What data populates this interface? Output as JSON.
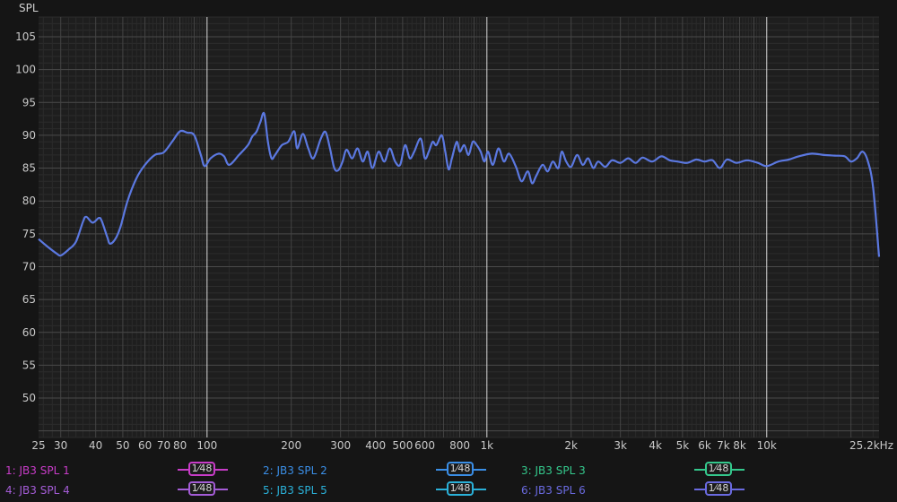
{
  "chart_data": {
    "type": "line",
    "ylabel": "SPL",
    "ylim": [
      44,
      108
    ],
    "xlim": [
      25,
      25200
    ],
    "xscale": "log",
    "grid": true,
    "y_ticks": [
      50,
      55,
      60,
      65,
      70,
      75,
      80,
      85,
      90,
      95,
      100,
      105
    ],
    "x_ticks": [
      {
        "v": 25,
        "label": "25"
      },
      {
        "v": 30,
        "label": "30"
      },
      {
        "v": 40,
        "label": "40"
      },
      {
        "v": 50,
        "label": "50"
      },
      {
        "v": 60,
        "label": "60"
      },
      {
        "v": 70,
        "label": "70"
      },
      {
        "v": 80,
        "label": "80"
      },
      {
        "v": 100,
        "label": "100"
      },
      {
        "v": 200,
        "label": "200"
      },
      {
        "v": 300,
        "label": "300"
      },
      {
        "v": 400,
        "label": "400"
      },
      {
        "v": 500,
        "label": "500"
      },
      {
        "v": 600,
        "label": "600"
      },
      {
        "v": 800,
        "label": "800"
      },
      {
        "v": 1000,
        "label": "1k"
      },
      {
        "v": 2000,
        "label": "2k"
      },
      {
        "v": 3000,
        "label": "3k"
      },
      {
        "v": 4000,
        "label": "4k"
      },
      {
        "v": 5000,
        "label": "5k"
      },
      {
        "v": 6000,
        "label": "6k"
      },
      {
        "v": 7000,
        "label": "7k"
      },
      {
        "v": 8000,
        "label": "8k"
      },
      {
        "v": 10000,
        "label": "10k"
      },
      {
        "v": 25200,
        "label": "25.2kHz"
      }
    ],
    "series": [
      {
        "name": "6: JB3 SPL 6",
        "color": "#5b78e0",
        "points": [
          [
            25,
            74.2
          ],
          [
            27,
            73.0
          ],
          [
            29,
            72.0
          ],
          [
            30,
            71.7
          ],
          [
            32,
            72.6
          ],
          [
            34,
            73.8
          ],
          [
            36,
            76.8
          ],
          [
            37,
            77.6
          ],
          [
            39,
            76.7
          ],
          [
            41,
            77.4
          ],
          [
            42,
            77.0
          ],
          [
            44,
            74.5
          ],
          [
            45,
            73.5
          ],
          [
            47,
            74.2
          ],
          [
            49,
            76.0
          ],
          [
            52,
            80.0
          ],
          [
            56,
            83.5
          ],
          [
            60,
            85.5
          ],
          [
            65,
            87.0
          ],
          [
            70,
            87.4
          ],
          [
            75,
            89.0
          ],
          [
            80,
            90.6
          ],
          [
            85,
            90.4
          ],
          [
            90,
            90.0
          ],
          [
            95,
            87.0
          ],
          [
            98,
            85.3
          ],
          [
            103,
            86.5
          ],
          [
            110,
            87.2
          ],
          [
            115,
            86.8
          ],
          [
            120,
            85.5
          ],
          [
            130,
            87.0
          ],
          [
            140,
            88.5
          ],
          [
            145,
            89.8
          ],
          [
            150,
            90.5
          ],
          [
            155,
            92.0
          ],
          [
            160,
            93.3
          ],
          [
            165,
            89.0
          ],
          [
            170,
            86.5
          ],
          [
            175,
            87.0
          ],
          [
            185,
            88.5
          ],
          [
            195,
            89.0
          ],
          [
            205,
            90.6
          ],
          [
            210,
            88.0
          ],
          [
            220,
            90.2
          ],
          [
            230,
            88.0
          ],
          [
            240,
            86.5
          ],
          [
            255,
            89.5
          ],
          [
            265,
            90.5
          ],
          [
            275,
            88.0
          ],
          [
            285,
            85.0
          ],
          [
            295,
            84.7
          ],
          [
            305,
            86.0
          ],
          [
            315,
            87.8
          ],
          [
            330,
            86.5
          ],
          [
            345,
            88.0
          ],
          [
            360,
            86.0
          ],
          [
            375,
            87.5
          ],
          [
            390,
            85.0
          ],
          [
            410,
            87.5
          ],
          [
            430,
            86.0
          ],
          [
            450,
            88.0
          ],
          [
            470,
            86.0
          ],
          [
            490,
            85.5
          ],
          [
            510,
            88.5
          ],
          [
            530,
            86.5
          ],
          [
            550,
            87.5
          ],
          [
            580,
            89.5
          ],
          [
            600,
            86.5
          ],
          [
            620,
            87.5
          ],
          [
            640,
            89.0
          ],
          [
            660,
            88.5
          ],
          [
            690,
            90.0
          ],
          [
            710,
            87.5
          ],
          [
            730,
            84.8
          ],
          [
            750,
            86.5
          ],
          [
            780,
            89.0
          ],
          [
            800,
            87.5
          ],
          [
            830,
            88.5
          ],
          [
            860,
            87.0
          ],
          [
            890,
            89.0
          ],
          [
            920,
            88.5
          ],
          [
            950,
            87.5
          ],
          [
            980,
            86.0
          ],
          [
            1010,
            87.5
          ],
          [
            1050,
            85.5
          ],
          [
            1100,
            88.0
          ],
          [
            1150,
            86.0
          ],
          [
            1200,
            87.2
          ],
          [
            1270,
            85.2
          ],
          [
            1330,
            83.0
          ],
          [
            1400,
            84.5
          ],
          [
            1450,
            82.7
          ],
          [
            1500,
            83.8
          ],
          [
            1580,
            85.5
          ],
          [
            1650,
            84.5
          ],
          [
            1720,
            86.0
          ],
          [
            1800,
            85.0
          ],
          [
            1850,
            87.5
          ],
          [
            1920,
            86.0
          ],
          [
            2000,
            85.2
          ],
          [
            2100,
            87.0
          ],
          [
            2200,
            85.5
          ],
          [
            2300,
            86.5
          ],
          [
            2400,
            85.0
          ],
          [
            2500,
            86.0
          ],
          [
            2650,
            85.2
          ],
          [
            2800,
            86.2
          ],
          [
            3000,
            85.8
          ],
          [
            3200,
            86.5
          ],
          [
            3400,
            85.8
          ],
          [
            3600,
            86.6
          ],
          [
            3900,
            86.0
          ],
          [
            4200,
            86.8
          ],
          [
            4500,
            86.2
          ],
          [
            4800,
            86.0
          ],
          [
            5200,
            85.8
          ],
          [
            5600,
            86.3
          ],
          [
            6000,
            86.0
          ],
          [
            6400,
            86.2
          ],
          [
            6800,
            85.0
          ],
          [
            7200,
            86.3
          ],
          [
            7800,
            85.8
          ],
          [
            8500,
            86.2
          ],
          [
            9300,
            85.8
          ],
          [
            10000,
            85.3
          ],
          [
            11000,
            86.0
          ],
          [
            12000,
            86.3
          ],
          [
            13000,
            86.8
          ],
          [
            14500,
            87.2
          ],
          [
            16000,
            87.0
          ],
          [
            17500,
            86.9
          ],
          [
            19000,
            86.8
          ],
          [
            20000,
            86.0
          ],
          [
            21000,
            86.5
          ],
          [
            22000,
            87.5
          ],
          [
            23000,
            86.0
          ],
          [
            24000,
            82.0
          ],
          [
            25200,
            71.5
          ]
        ]
      }
    ]
  },
  "legend": {
    "items": [
      {
        "label": "1: JB3 SPL 1",
        "color": "#c83cc8",
        "smoothing": "1⁄48"
      },
      {
        "label": "2: JB3 SPL 2",
        "color": "#3a8ee6",
        "smoothing": "1⁄48"
      },
      {
        "label": "3: JB3 SPL 3",
        "color": "#34c88c",
        "smoothing": "1⁄48"
      },
      {
        "label": "4: JB3 SPL 4",
        "color": "#a45cd6",
        "smoothing": "1⁄48"
      },
      {
        "label": "5: JB3 SPL 5",
        "color": "#2ab0d8",
        "smoothing": "1⁄48"
      },
      {
        "label": "6: JB3 SPL 6",
        "color": "#6a6ae0",
        "smoothing": "1⁄48"
      }
    ]
  }
}
